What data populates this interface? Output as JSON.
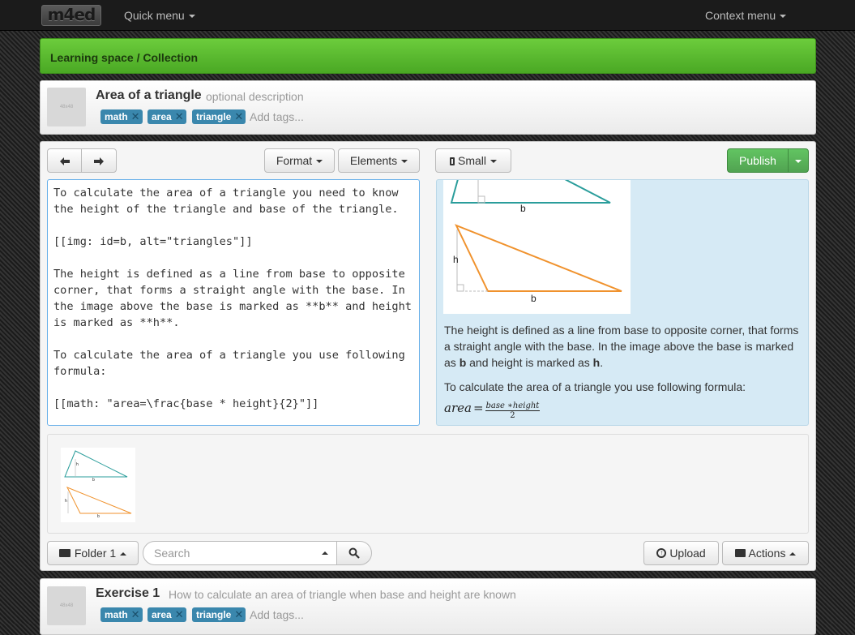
{
  "nav": {
    "logo": "m4ed",
    "quick_menu": "Quick menu",
    "context_menu": "Context menu"
  },
  "breadcrumb": "Learning space / Collection",
  "header": {
    "thumb": "48x48",
    "title": "Area of a triangle",
    "description": "optional description",
    "tags": [
      "math",
      "area",
      "triangle"
    ],
    "tags_placeholder": "Add tags..."
  },
  "toolbar": {
    "format": "Format",
    "elements": "Elements",
    "size": "Small",
    "publish": "Publish"
  },
  "editor": {
    "lines": [
      "To calculate the area of a triangle you need to know",
      "the height of the triangle and base of the triangle.",
      "",
      "[[img: id=b, alt=\"triangles\"]]",
      "",
      "The height is defined as a line from base to opposite",
      "corner, that forms a straight angle with the base. In",
      "the image above the base is marked as **b** and height",
      "is marked as **h**.",
      "",
      "To calculate the area of a triangle you use following",
      "formula:",
      "",
      "[[math: \"area=\\frac{base * height}{2}\"]]"
    ]
  },
  "preview": {
    "label_b1": "b",
    "label_h": "h",
    "label_b2": "b",
    "para1_text": "The height is defined as a line from base to opposite corner, that forms a straight angle with the base. In the image above the base is marked as ",
    "para1_b": "b",
    "para1_mid": " and height is marked as ",
    "para1_h": "h",
    "para1_end": ".",
    "para2": "To calculate the area of a triangle you use following formula:",
    "math_lhs": "area",
    "math_eq": "=",
    "math_num": "base ∗height",
    "math_den": "2"
  },
  "gallery": {
    "h": "h",
    "b": "b"
  },
  "bottom": {
    "folder": "Folder 1",
    "search_placeholder": "Search",
    "upload": "Upload",
    "actions": "Actions"
  },
  "exercise": {
    "thumb": "48x48",
    "title": "Exercise 1",
    "description": "How to calculate an area of triangle when base and height are known",
    "tags": [
      "math",
      "area",
      "triangle"
    ],
    "tags_placeholder": "Add tags..."
  },
  "colors": {
    "teal": "#2a9d9b",
    "orange": "#f0922d",
    "green": "#51a351",
    "tag": "#3a87ad"
  }
}
